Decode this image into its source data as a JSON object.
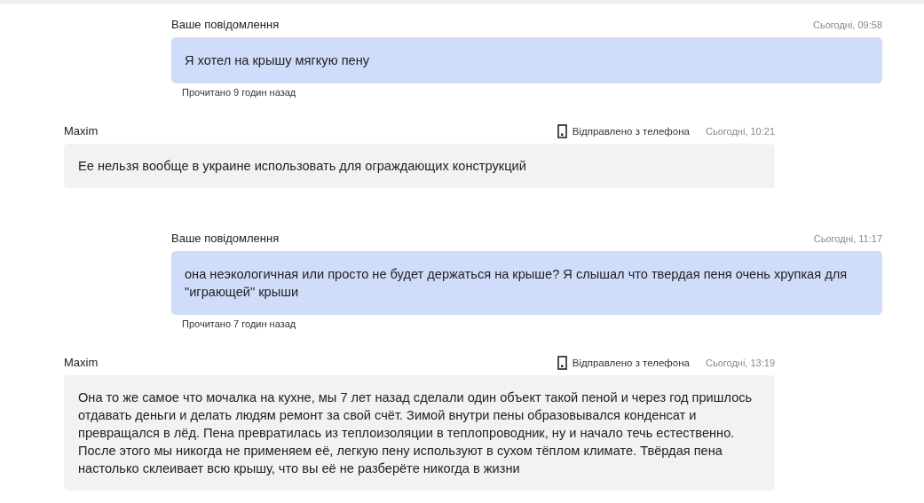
{
  "messages": [
    {
      "kind": "own",
      "sender": "Ваше повідомлення",
      "time": "Сьогодні, 09:58",
      "text": "Я хотел на крышу мягкую пену",
      "read_status": "Прочитано 9 годин назад"
    },
    {
      "kind": "incoming",
      "sender": "Maxim",
      "device": "Відправлено з телефона",
      "time": "Сьогодні, 10:21",
      "text": "Ее нельзя вообще в украине использовать для ограждающих конструкций"
    },
    {
      "kind": "own",
      "sender": "Ваше повідомлення",
      "time": "Сьогодні, 11:17",
      "text": "она неэкологичная или просто не будет держаться на крыше? Я слышал что твердая пеня очень хрупкая для \"играющей\" крыши",
      "read_status": "Прочитано 7 годин назад"
    },
    {
      "kind": "incoming",
      "sender": "Maxim",
      "device": "Відправлено з телефона",
      "time": "Сьогодні, 13:19",
      "text": "Она то же самое что мочалка на кухне, мы 7 лет назад сделали один объект такой пеной и через год пришлось отдавать деньги и делать людям ремонт за свой счёт. Зимой внутри пены образовывался конденсат и превращался в лёд. Пена превратилась из теплоизоляции в теплопроводник, ну и начало течь естественно. После этого мы никогда не применяем её, легкую пену используют в сухом тёплом климате. Твёрдая пена настолько склеивает всю крышу, что вы её не разберёте никогда в жизни"
    }
  ]
}
